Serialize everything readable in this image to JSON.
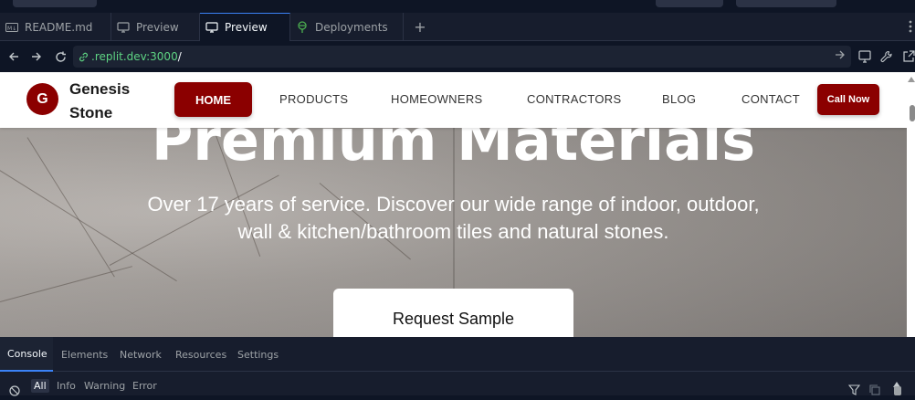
{
  "editor_tabs": [
    {
      "label": "README.md",
      "icon": "markdown-file-icon",
      "active": false
    },
    {
      "label": "Preview",
      "icon": "monitor-icon",
      "active": false
    },
    {
      "label": "Preview",
      "icon": "monitor-icon",
      "active": true
    },
    {
      "label": "Deployments",
      "icon": "deployments-icon",
      "active": false
    }
  ],
  "new_tab_label": "+",
  "address_bar": {
    "host": ".replit.dev:3000",
    "path": "/"
  },
  "site": {
    "logo_letter": "G",
    "logo_name": "Genesis Stone",
    "nav": {
      "home": "HOME",
      "products": "PRODUCTS",
      "homeowners": "HOMEOWNERS",
      "contractors": "CONTRACTORS",
      "blog": "BLOG",
      "contact": "CONTACT"
    },
    "call_label": "Call Now",
    "hero_title": "Premium Materials",
    "hero_subtitle": "Over 17 years of service. Discover our wide range of indoor, outdoor, wall & kitchen/bathroom tiles and natural stones.",
    "cta_label": "Request Sample"
  },
  "devtools": {
    "tabs": [
      "Console",
      "Elements",
      "Network",
      "Resources",
      "Settings"
    ],
    "active_tab": "Console",
    "filters": [
      "All",
      "Info",
      "Warning",
      "Error"
    ],
    "active_filter": "All"
  },
  "colors": {
    "brand_red": "#8b0000",
    "ide_bg": "#0e1525",
    "url_host_green": "#5ed483",
    "active_tab_accent": "#3b82f6"
  }
}
